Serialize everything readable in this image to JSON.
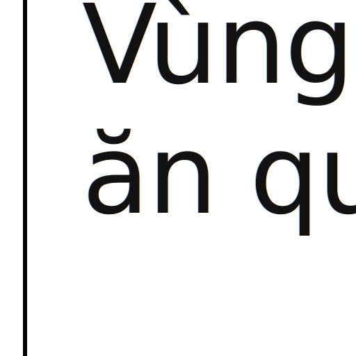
{
  "document": {
    "lines": [
      "Vùng",
      "ăn qu"
    ]
  }
}
